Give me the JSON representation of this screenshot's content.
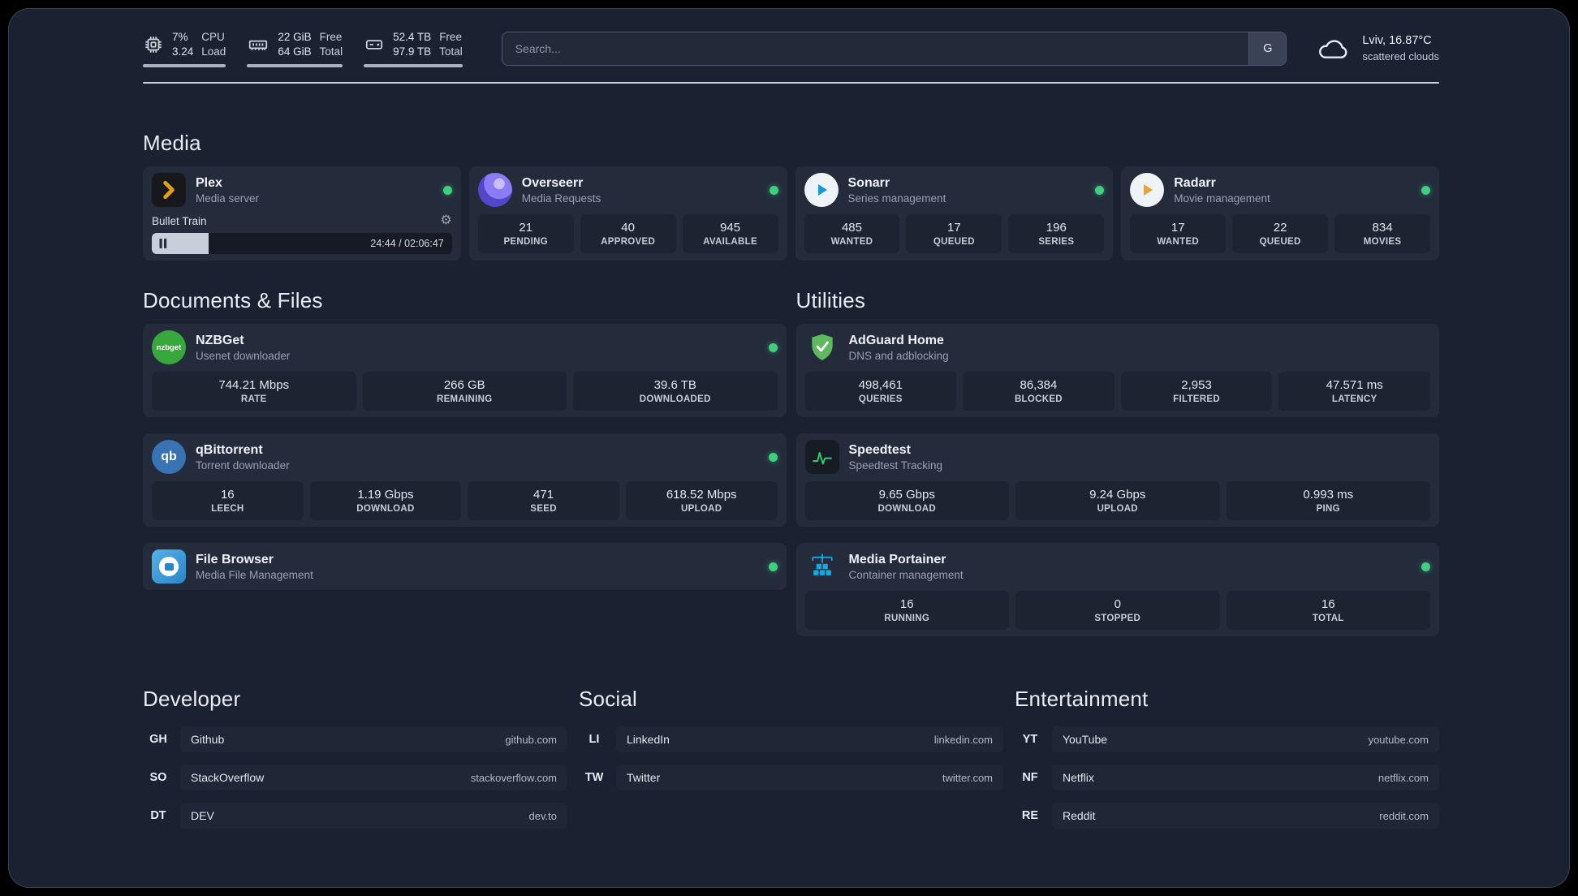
{
  "colors": {
    "status_online": "#3ed17d",
    "plex_amber": "#e5a00d",
    "background": "#1a2231",
    "card": "#242c3c"
  },
  "icons": {
    "settings_gear": "⚙"
  },
  "topbar": {
    "cpu": {
      "usage": "7%",
      "load": "3.24",
      "labels": [
        "CPU",
        "Load"
      ]
    },
    "memory": {
      "free": "22 GiB",
      "total": "64 GiB",
      "labels": [
        "Free",
        "Total"
      ]
    },
    "disk": {
      "free": "52.4 TB",
      "total": "97.9 TB",
      "labels": [
        "Free",
        "Total"
      ]
    },
    "search": {
      "placeholder": "Search...",
      "button": "G"
    },
    "weather": {
      "location": "Lviv, 16.87°C",
      "condition": "scattered clouds"
    }
  },
  "sections": {
    "media": "Media",
    "documents": "Documents & Files",
    "utilities": "Utilities"
  },
  "plex": {
    "name": "Plex",
    "desc": "Media server",
    "now_playing": "Bullet Train",
    "time": "24:44 / 02:06:47"
  },
  "media_apps": [
    {
      "name": "Overseerr",
      "desc": "Media Requests",
      "stats": [
        {
          "v": "21",
          "l": "PENDING"
        },
        {
          "v": "40",
          "l": "APPROVED"
        },
        {
          "v": "945",
          "l": "AVAILABLE"
        }
      ]
    },
    {
      "name": "Sonarr",
      "desc": "Series management",
      "stats": [
        {
          "v": "485",
          "l": "WANTED"
        },
        {
          "v": "17",
          "l": "QUEUED"
        },
        {
          "v": "196",
          "l": "SERIES"
        }
      ]
    },
    {
      "name": "Radarr",
      "desc": "Movie management",
      "stats": [
        {
          "v": "17",
          "l": "WANTED"
        },
        {
          "v": "22",
          "l": "QUEUED"
        },
        {
          "v": "834",
          "l": "MOVIES"
        }
      ]
    }
  ],
  "document_apps": [
    {
      "name": "NZBGet",
      "desc": "Usenet downloader",
      "icon_text": "nzbget",
      "stats": [
        {
          "v": "744.21 Mbps",
          "l": "RATE"
        },
        {
          "v": "266 GB",
          "l": "REMAINING"
        },
        {
          "v": "39.6 TB",
          "l": "DOWNLOADED"
        }
      ]
    },
    {
      "name": "qBittorrent",
      "desc": "Torrent downloader",
      "icon_text": "qb",
      "stats": [
        {
          "v": "16",
          "l": "LEECH"
        },
        {
          "v": "1.19 Gbps",
          "l": "DOWNLOAD"
        },
        {
          "v": "471",
          "l": "SEED"
        },
        {
          "v": "618.52 Mbps",
          "l": "UPLOAD"
        }
      ]
    },
    {
      "name": "File Browser",
      "desc": "Media File Management",
      "stats": []
    }
  ],
  "utility_apps": [
    {
      "name": "AdGuard Home",
      "desc": "DNS and adblocking",
      "stats": [
        {
          "v": "498,461",
          "l": "QUERIES"
        },
        {
          "v": "86,384",
          "l": "BLOCKED"
        },
        {
          "v": "2,953",
          "l": "FILTERED"
        },
        {
          "v": "47.571 ms",
          "l": "LATENCY"
        }
      ]
    },
    {
      "name": "Speedtest",
      "desc": "Speedtest Tracking",
      "stats": [
        {
          "v": "9.65 Gbps",
          "l": "DOWNLOAD"
        },
        {
          "v": "9.24 Gbps",
          "l": "UPLOAD"
        },
        {
          "v": "0.993 ms",
          "l": "PING"
        }
      ]
    },
    {
      "name": "Media Portainer",
      "desc": "Container management",
      "stats": [
        {
          "v": "16",
          "l": "RUNNING"
        },
        {
          "v": "0",
          "l": "STOPPED"
        },
        {
          "v": "16",
          "l": "TOTAL"
        }
      ]
    }
  ],
  "bookmarks": {
    "developer": {
      "title": "Developer",
      "items": [
        {
          "abbr": "GH",
          "name": "Github",
          "domain": "github.com"
        },
        {
          "abbr": "SO",
          "name": "StackOverflow",
          "domain": "stackoverflow.com"
        },
        {
          "abbr": "DT",
          "name": "DEV",
          "domain": "dev.to"
        }
      ]
    },
    "social": {
      "title": "Social",
      "items": [
        {
          "abbr": "LI",
          "name": "LinkedIn",
          "domain": "linkedin.com"
        },
        {
          "abbr": "TW",
          "name": "Twitter",
          "domain": "twitter.com"
        }
      ]
    },
    "entertainment": {
      "title": "Entertainment",
      "items": [
        {
          "abbr": "YT",
          "name": "YouTube",
          "domain": "youtube.com"
        },
        {
          "abbr": "NF",
          "name": "Netflix",
          "domain": "netflix.com"
        },
        {
          "abbr": "RE",
          "name": "Reddit",
          "domain": "reddit.com"
        }
      ]
    }
  }
}
